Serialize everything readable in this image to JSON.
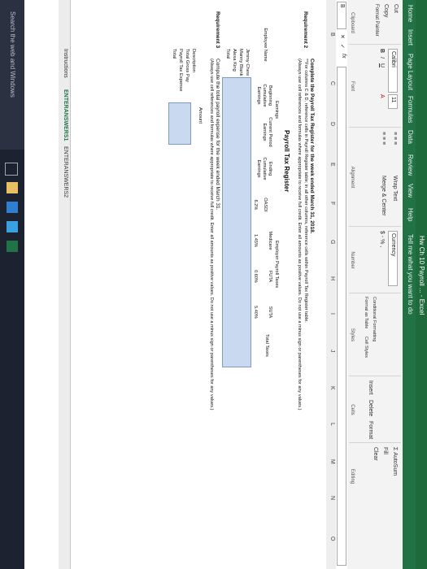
{
  "window": {
    "title": "Hw Ch 10 Payroll ... - Excel"
  },
  "tabs": [
    "Home",
    "Insert",
    "Page Layout",
    "Formulas",
    "Data",
    "Review",
    "View",
    "Help",
    "Tell me what you want to do"
  ],
  "ribbon": {
    "cut": "Cut",
    "copy": "Copy",
    "format_painter": "Format Painter",
    "clipboard": "Clipboard",
    "font_name": "Calibri",
    "font_size": "11",
    "font": "Font",
    "wrap_text": "Wrap Text",
    "merge_center": "Merge & Center",
    "alignment": "Alignment",
    "number_format": "Currency",
    "number_symbols": "$ - % ,",
    "number": "Number",
    "conditional": "Conditional Formatting",
    "format_table": "Format as Table",
    "cell_styles": "Cell Styles",
    "styles": "Styles",
    "insert": "Insert",
    "delete": "Delete",
    "format": "Format",
    "cells": "Cells",
    "autosum": "AutoSum",
    "fill": "Fill",
    "clear": "Clear",
    "editing": "Editing"
  },
  "formula_bar": {
    "namebox": "B",
    "fx": "fx"
  },
  "columns": [
    "B",
    "C",
    "D",
    "E",
    "F",
    "G",
    "H",
    "I",
    "J",
    "K",
    "L",
    "M",
    "N",
    "O"
  ],
  "sheet": {
    "req2_label": "Requirement 2",
    "req2_line1": "Complete the Payroll Tax Register for the week ended March 31, 2018.",
    "req2_line2": "**For columns C & D, reference cells in Payroll Register table; in all other columns, reference cells within Payroll Tax Register table.",
    "req2_line3": "(Always use cell references and formulas where appropriate to receive full credit. Enter all amounts as positive values. Do not use a minus sign or parentheses for any values.)",
    "register_title": "Payroll Tax Register",
    "earnings": "Earnings",
    "employer_taxes": "Employer Payroll Taxes",
    "h_employee": "Employee Name",
    "h_beg": "Beginning Cumulative Earnings",
    "h_cur": "Current Period Earnings",
    "h_end": "Ending Cumulative Earnings",
    "h_oasdi": "OASDI",
    "h_medicare": "Medicare",
    "h_futa": "FUTA",
    "h_suta": "SUTA",
    "h_total": "Total Taxes",
    "rate_oasdi": "6.2%",
    "rate_medicare": "1.45%",
    "rate_futa": "0.60%",
    "rate_suta": "5.40%",
    "employees": [
      "Jimmy Chew",
      "Manny Blank",
      "Alexa King",
      "Total"
    ],
    "req3_label": "Requirement 3",
    "req3_line1": "Compute the total payroll expense for the week ended March 31.",
    "req3_line2": "(Always use cell references and formulas where appropriate to receive full credit. Enter all amounts as positive values. Do not use a minus sign or parentheses for any values.)",
    "exp_description": "Description",
    "exp_amount": "Amount",
    "exp_rows": [
      "Total Gross Pay",
      "Payroll Tax Expense",
      "Total"
    ]
  },
  "sheet_tabs": [
    "Instructions",
    "ENTERANSWERS1",
    "ENTERANSWERS2"
  ],
  "taskbar": {
    "search": "Search the web and Windows"
  }
}
